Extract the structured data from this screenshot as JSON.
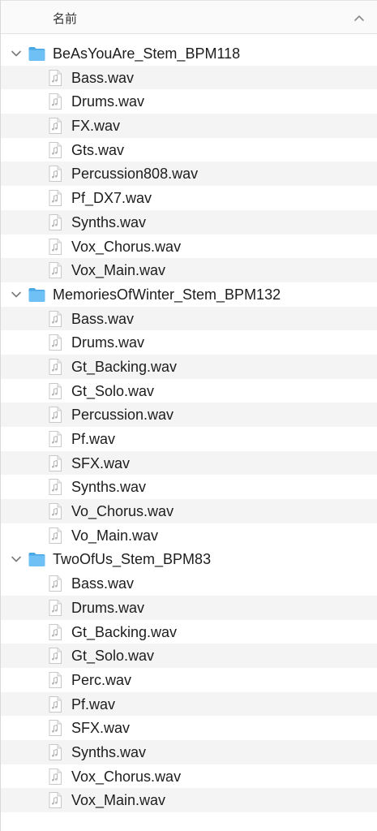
{
  "header": {
    "name_column": "名前"
  },
  "folders": [
    {
      "name": "BeAsYouAre_Stem_BPM118",
      "files": [
        "Bass.wav",
        "Drums.wav",
        "FX.wav",
        "Gts.wav",
        "Percussion808.wav",
        "Pf_DX7.wav",
        "Synths.wav",
        "Vox_Chorus.wav",
        "Vox_Main.wav"
      ]
    },
    {
      "name": "MemoriesOfWinter_Stem_BPM132",
      "files": [
        "Bass.wav",
        "Drums.wav",
        "Gt_Backing.wav",
        "Gt_Solo.wav",
        "Percussion.wav",
        "Pf.wav",
        "SFX.wav",
        "Synths.wav",
        "Vo_Chorus.wav",
        "Vo_Main.wav"
      ]
    },
    {
      "name": "TwoOfUs_Stem_BPM83",
      "files": [
        "Bass.wav",
        "Drums.wav",
        "Gt_Backing.wav",
        "Gt_Solo.wav",
        "Perc.wav",
        "Pf.wav",
        "SFX.wav",
        "Synths.wav",
        "Vox_Chorus.wav",
        "Vox_Main.wav"
      ]
    }
  ],
  "icons": {
    "sort": "chevron-up-icon",
    "disclosure": "chevron-down-icon",
    "folder": "folder-icon",
    "file": "audio-file-icon"
  },
  "colors": {
    "folder_blue": "#5cb5f0",
    "alt_row": "#f4f4f4",
    "text": "#1d1d1d"
  }
}
